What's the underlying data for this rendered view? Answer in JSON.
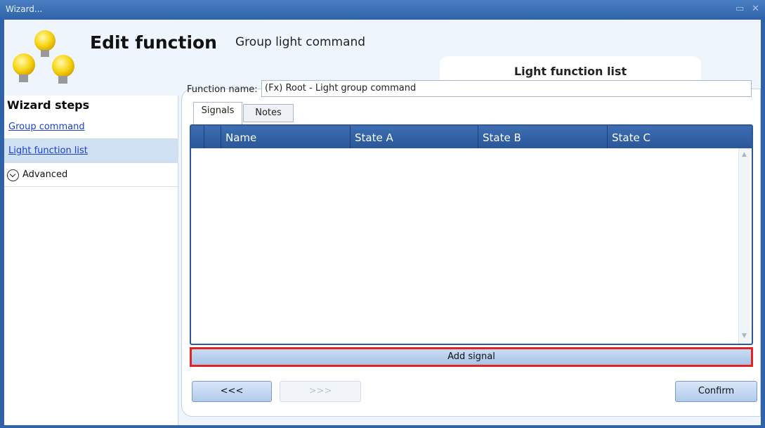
{
  "window": {
    "title": "Wizard..."
  },
  "header": {
    "title": "Edit function",
    "subtitle": "Group light command",
    "tab_heading": "Light function list"
  },
  "sidebar": {
    "heading": "Wizard steps",
    "items": [
      {
        "label": "Group command",
        "active": false
      },
      {
        "label": "Light function list",
        "active": true
      },
      {
        "label": "Advanced",
        "expandable": true
      }
    ]
  },
  "form": {
    "function_name_label": "Function name:",
    "function_name_value": "(Fx) Root - Light group command"
  },
  "tabs": [
    {
      "label": "Signals",
      "selected": true
    },
    {
      "label": "Notes",
      "selected": false
    }
  ],
  "grid": {
    "columns": [
      "",
      "Name",
      "State A",
      "State B",
      "State C"
    ],
    "rows": []
  },
  "buttons": {
    "add_signal": "Add signal",
    "prev": "<<<",
    "next": ">>>",
    "confirm": "Confirm"
  },
  "colors": {
    "highlight": "#e32222",
    "accent": "#2c5896"
  }
}
